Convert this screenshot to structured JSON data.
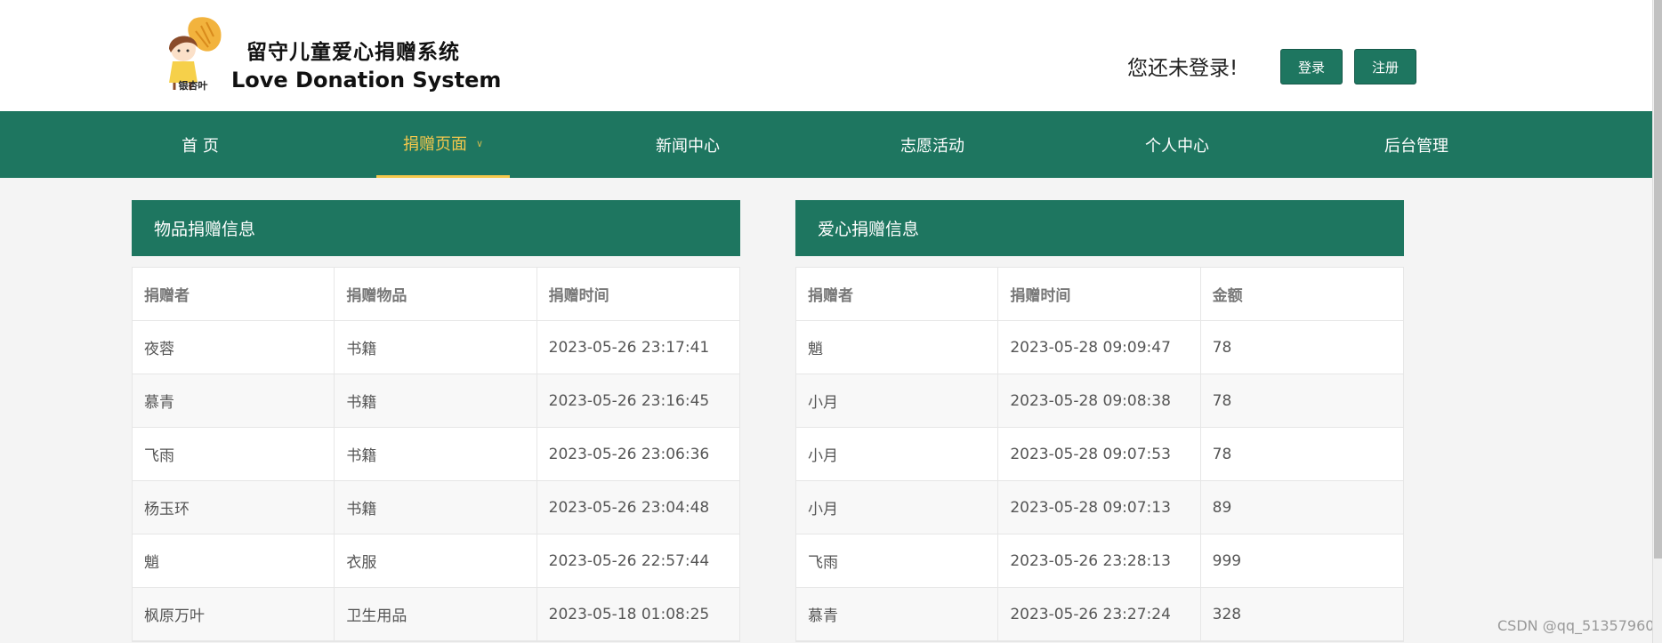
{
  "header": {
    "logo_text": "银杏叶",
    "title_cn": "留守儿童爱心捐赠系统",
    "title_en": "Love Donation System",
    "login_hint": "您还未登录!",
    "login_button": "登录",
    "register_button": "注册"
  },
  "nav": {
    "items": [
      "首 页",
      "捐赠页面",
      "新闻中心",
      "志愿活动",
      "个人中心",
      "后台管理"
    ],
    "active_index": 1
  },
  "goods_panel": {
    "title": "物品捐赠信息",
    "columns": [
      "捐赠者",
      "捐赠物品",
      "捐赠时间"
    ],
    "rows": [
      [
        "夜蓉",
        "书籍",
        "2023-05-26 23:17:41"
      ],
      [
        "慕青",
        "书籍",
        "2023-05-26 23:16:45"
      ],
      [
        "飞雨",
        "书籍",
        "2023-05-26 23:06:36"
      ],
      [
        "杨玉环",
        "书籍",
        "2023-05-26 23:04:48"
      ],
      [
        "魈",
        "衣服",
        "2023-05-26 22:57:44"
      ],
      [
        "枫原万叶",
        "卫生用品",
        "2023-05-18 01:08:25"
      ]
    ]
  },
  "love_panel": {
    "title": "爱心捐赠信息",
    "columns": [
      "捐赠者",
      "捐赠时间",
      "金额"
    ],
    "rows": [
      [
        "魈",
        "2023-05-28 09:09:47",
        "78"
      ],
      [
        "小月",
        "2023-05-28 09:08:38",
        "78"
      ],
      [
        "小月",
        "2023-05-28 09:07:53",
        "78"
      ],
      [
        "小月",
        "2023-05-28 09:07:13",
        "89"
      ],
      [
        "飞雨",
        "2023-05-26 23:28:13",
        "999"
      ],
      [
        "慕青",
        "2023-05-26 23:27:24",
        "328"
      ]
    ]
  },
  "watermark": "CSDN @qq_51357960",
  "colors": {
    "brand_green": "#1e7660",
    "active_yellow": "#f5c84c",
    "background": "#f4f4f4"
  }
}
